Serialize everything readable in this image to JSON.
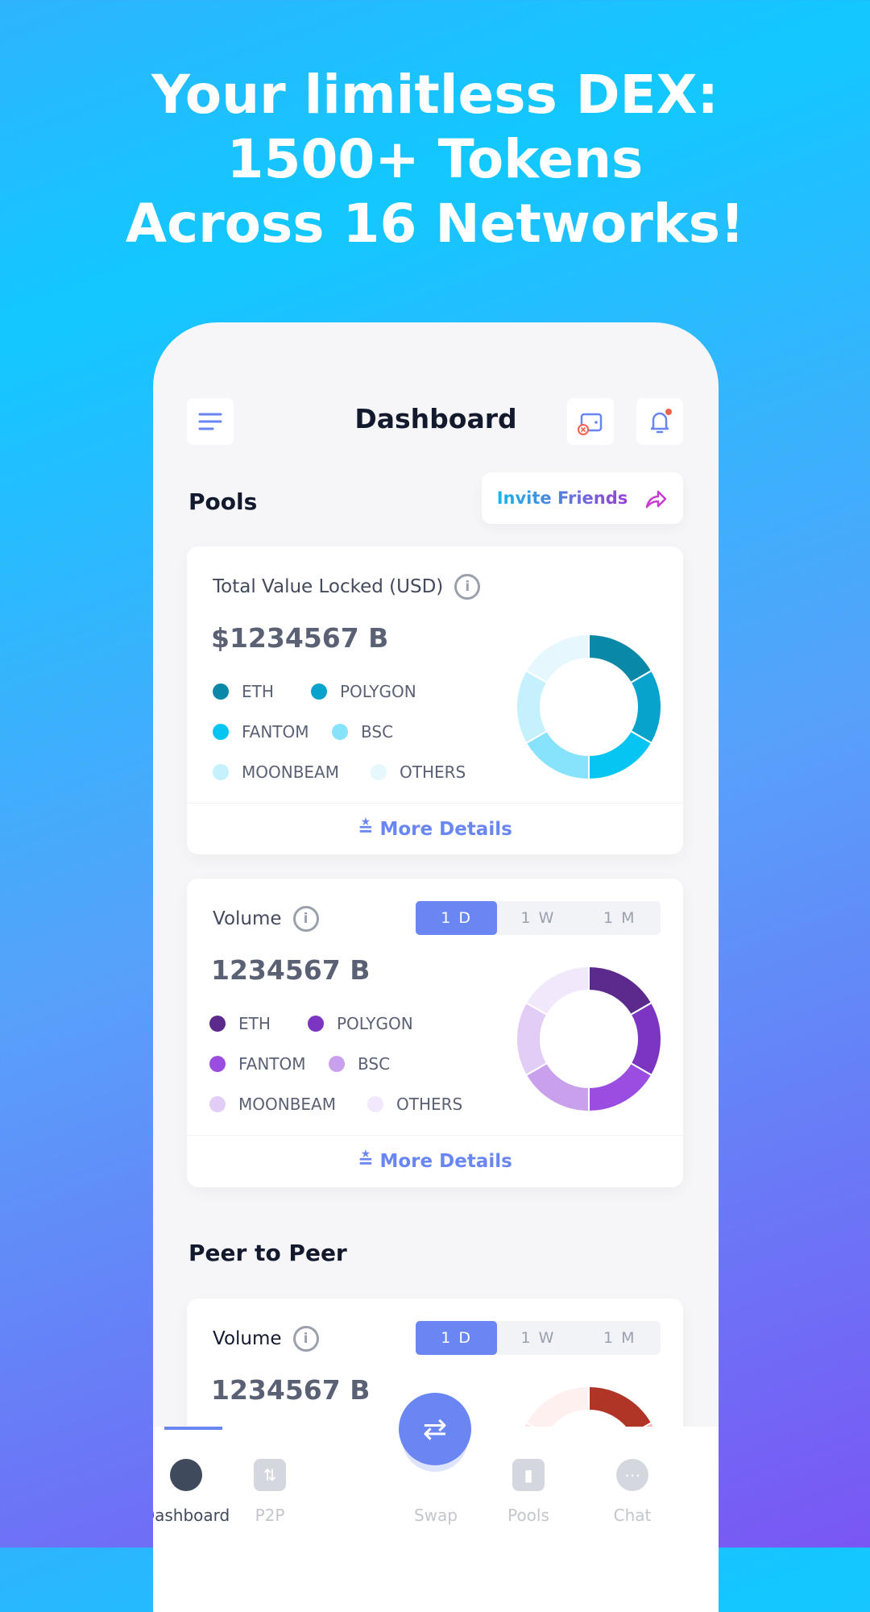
{
  "headline": [
    "Your limitless DEX:",
    "1500+ Tokens",
    "Across 16 Networks!"
  ],
  "header": {
    "title": "Dashboard",
    "menu_icon": "menu-icon",
    "wallet_icon": "wallet-disconnected-icon",
    "bell_icon": "bell-icon",
    "notification_color": "#f0614f"
  },
  "pools": {
    "title": "Pools",
    "invite_label": "Invite Friends",
    "tvl": {
      "title": "Total Value Locked (USD)",
      "value": "$1234567 B",
      "more": "More Details",
      "legend": [
        {
          "label": "ETH",
          "color": "#0a88a8"
        },
        {
          "label": "POLYGON",
          "color": "#08a3cc"
        },
        {
          "label": "FANTOM",
          "color": "#07c5f2"
        },
        {
          "label": "BSC",
          "color": "#87e3fb"
        },
        {
          "label": "MOONBEAM",
          "color": "#c4f1fc"
        },
        {
          "label": "OTHERS",
          "color": "#e6f8fd"
        }
      ]
    },
    "volume": {
      "title": "Volume",
      "value": "1234567 B",
      "more": "More Details",
      "periods": [
        "1 D",
        "1 W",
        "1 M"
      ],
      "selected": "1 D",
      "legend": [
        {
          "label": "ETH",
          "color": "#5b2a8c"
        },
        {
          "label": "POLYGON",
          "color": "#7b35c0"
        },
        {
          "label": "FANTOM",
          "color": "#9a4de0"
        },
        {
          "label": "BSC",
          "color": "#c8a0ec"
        },
        {
          "label": "MOONBEAM",
          "color": "#e2cdf6"
        },
        {
          "label": "OTHERS",
          "color": "#f1e8fb"
        }
      ]
    }
  },
  "p2p": {
    "title": "Peer to Peer",
    "volume": {
      "title": "Volume",
      "value": "1234567 B",
      "periods": [
        "1 D",
        "1 W",
        "1 M"
      ],
      "selected": "1 D",
      "colors": [
        "#b03526",
        "#f4b8ae",
        "#f8cdc6",
        "#fadcd7",
        "#fbe6e2",
        "#fdf0ee"
      ]
    }
  },
  "nav": {
    "items": [
      "Dashboard",
      "P2P",
      "Swap",
      "Pools",
      "Chat"
    ],
    "active": "Dashboard"
  }
}
